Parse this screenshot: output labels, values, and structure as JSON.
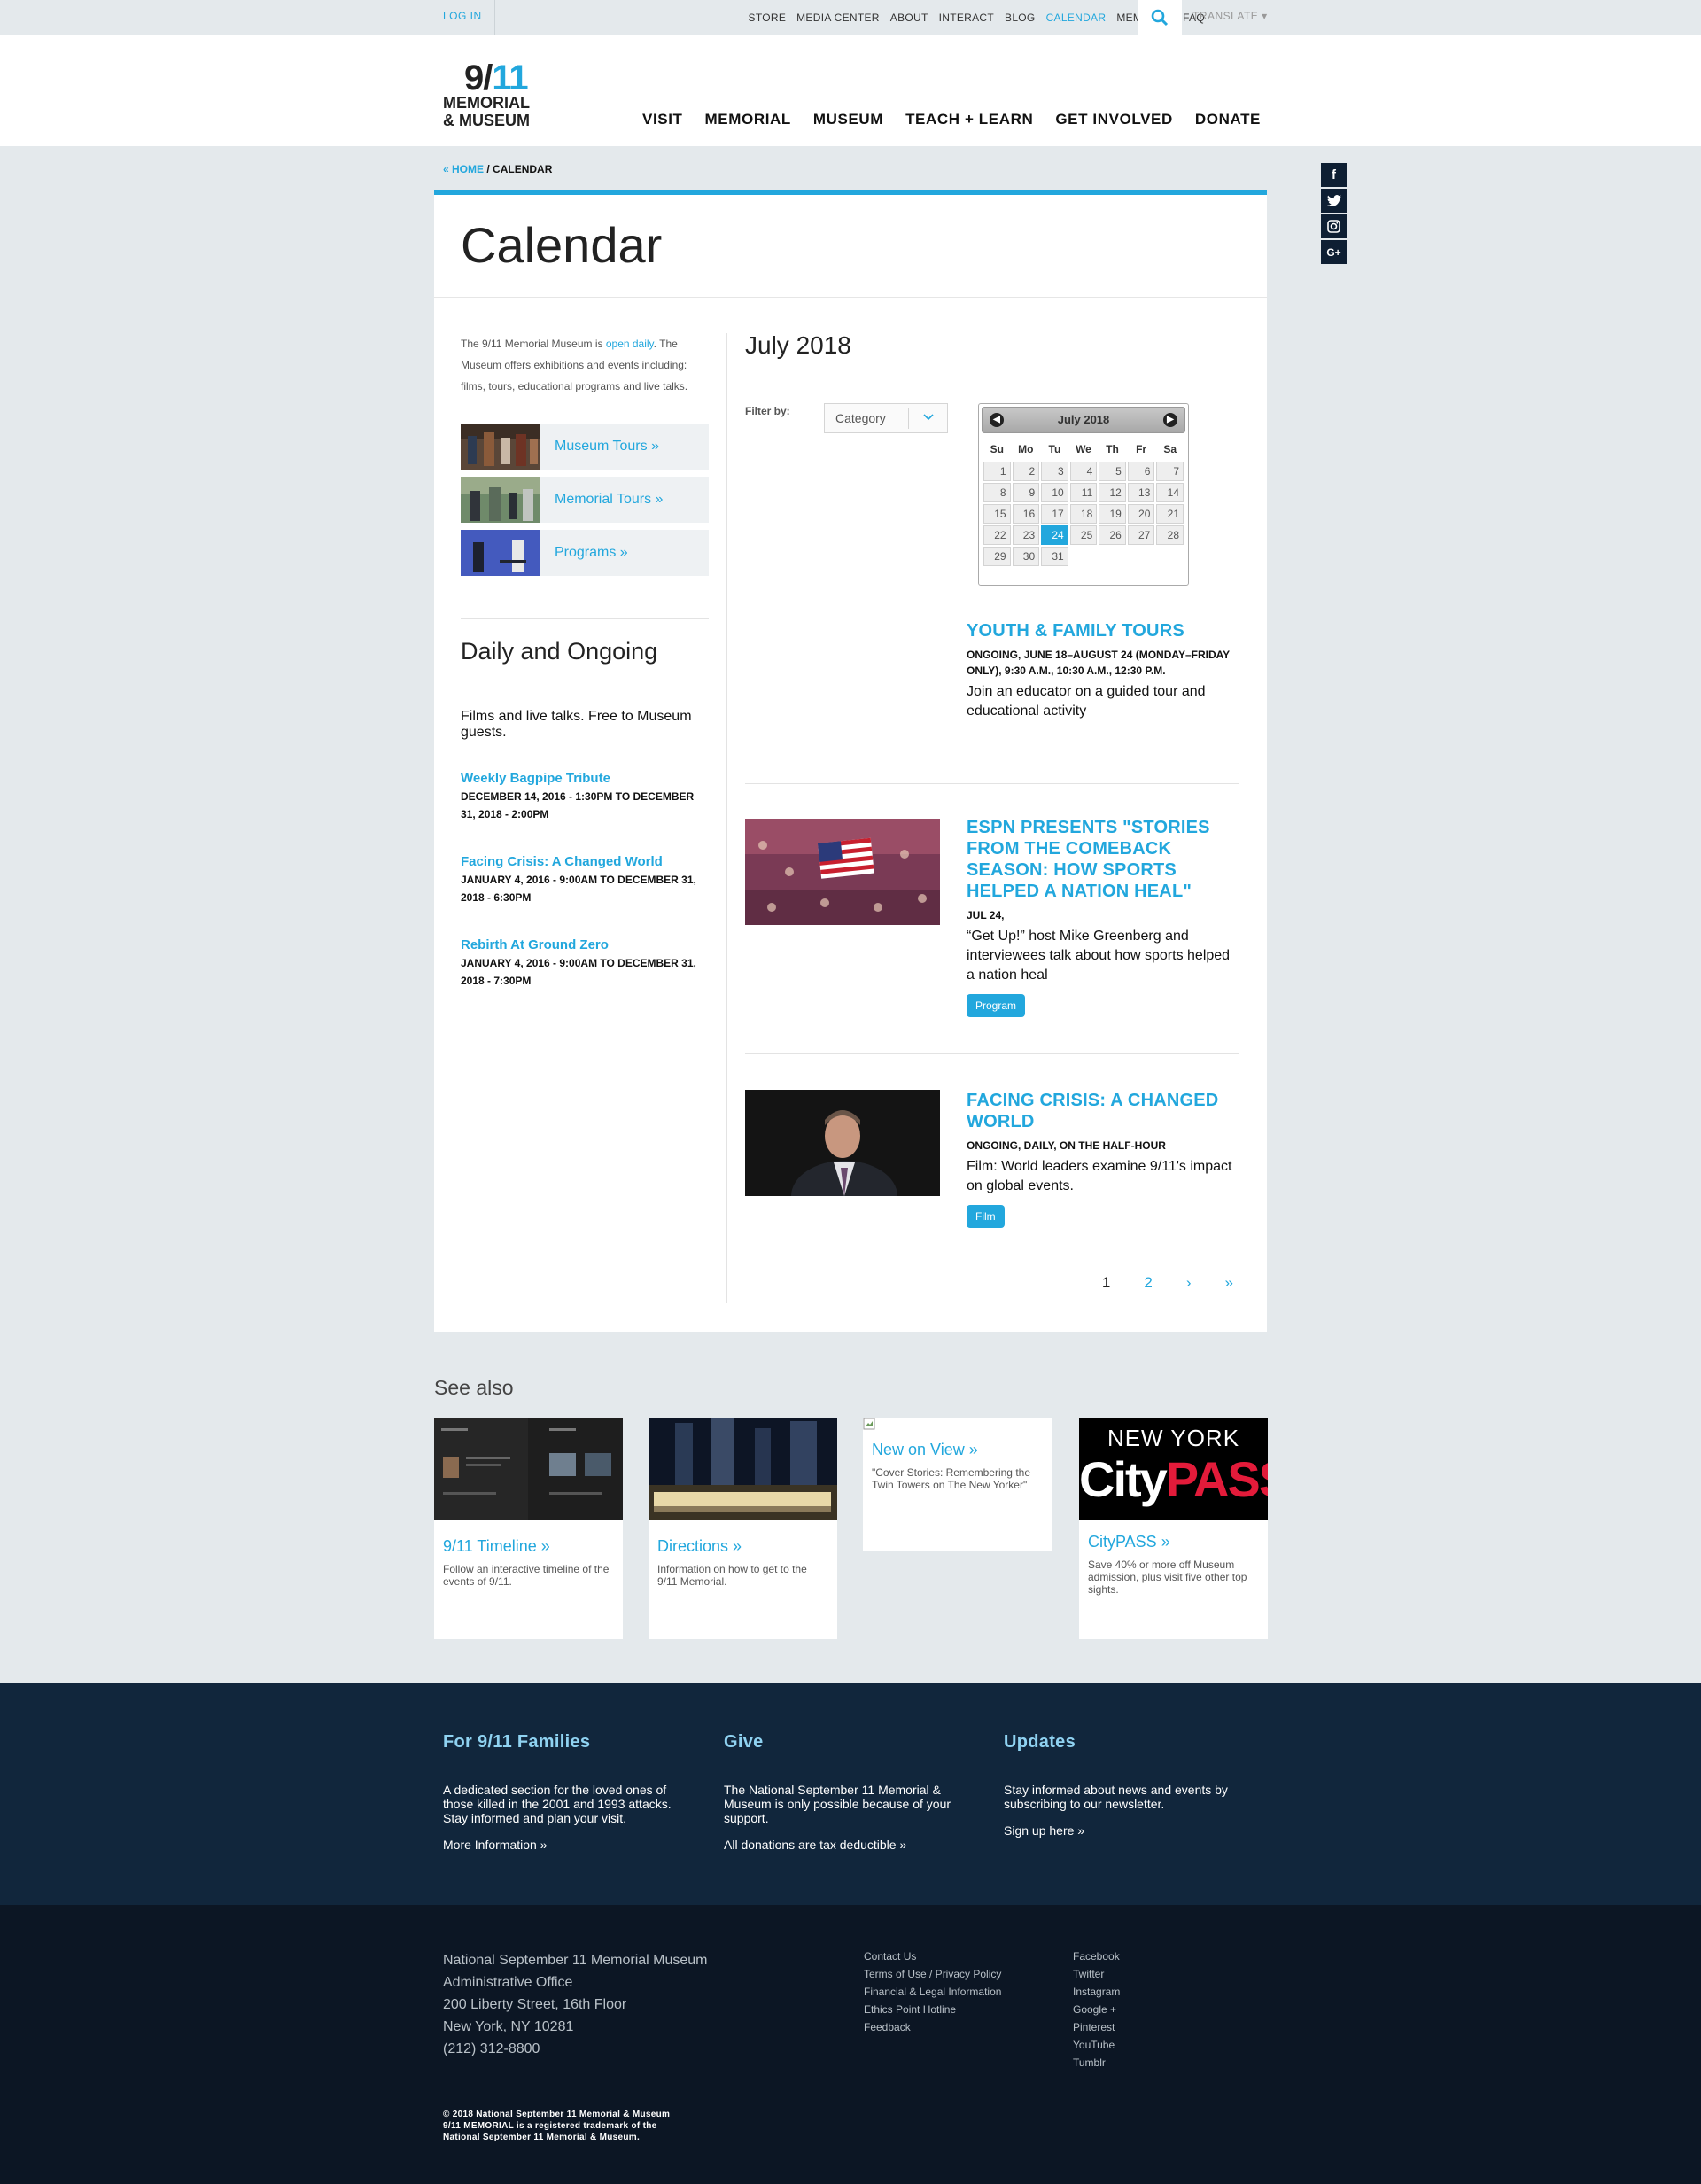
{
  "topbar": {
    "login": "LOG IN",
    "nav": [
      "STORE",
      "MEDIA CENTER",
      "ABOUT",
      "INTERACT",
      "BLOG",
      "CALENDAR",
      "MEMBERS",
      "FAQ"
    ],
    "active": "CALENDAR",
    "translate": "TRANSLATE ▾"
  },
  "logo": {
    "line1a": "9/",
    "line1b": "11",
    "line2": "MEMORIAL",
    "line3": "& MUSEUM"
  },
  "mainnav": [
    "VISIT",
    "MEMORIAL",
    "MUSEUM",
    "TEACH + LEARN",
    "GET INVOLVED",
    "DONATE"
  ],
  "breadcrumb": {
    "home": "« HOME",
    "sep": " / ",
    "current": "CALENDAR"
  },
  "social": [
    "f",
    "t",
    "ig",
    "G+"
  ],
  "page": {
    "title": "Calendar",
    "intro_pre": "The 9/11 Memorial Museum is ",
    "intro_link": "open daily",
    "intro_post": ". The Museum offers exhibitions and events including: films, tours, educational programs and live talks.",
    "side_buttons": [
      "Museum Tours »",
      "Memorial Tours »",
      "Programs »"
    ],
    "daily_title": "Daily and Ongoing",
    "daily_desc": "Films and live talks. Free to Museum guests.",
    "side_events": [
      {
        "title": "Weekly Bagpipe Tribute",
        "date": "December 14, 2016 - 1:30pm to December 31, 2018 - 2:00pm"
      },
      {
        "title": "Facing Crisis: A Changed World",
        "date": "January 4, 2016 - 9:00am to December 31, 2018 - 6:30pm"
      },
      {
        "title": "Rebirth At Ground Zero",
        "date": "January 4, 2016 - 9:00am to December 31, 2018 - 7:30pm"
      }
    ]
  },
  "calendar": {
    "month_title": "July 2018",
    "filter_label": "Filter by:",
    "category": "Category",
    "datepicker": {
      "title": "July 2018",
      "days": [
        "Su",
        "Mo",
        "Tu",
        "We",
        "Th",
        "Fr",
        "Sa"
      ],
      "selected": "24",
      "weeks": [
        [
          "1",
          "2",
          "3",
          "4",
          "5",
          "6",
          "7"
        ],
        [
          "8",
          "9",
          "10",
          "11",
          "12",
          "13",
          "14"
        ],
        [
          "15",
          "16",
          "17",
          "18",
          "19",
          "20",
          "21"
        ],
        [
          "22",
          "23",
          "24",
          "25",
          "26",
          "27",
          "28"
        ],
        [
          "29",
          "30",
          "31",
          "",
          "",
          "",
          ""
        ]
      ]
    }
  },
  "events": [
    {
      "title": "Youth & Family Tours",
      "date": "Ongoing, June 18–August 24 (Monday–Friday only), 9:30 a.m., 10:30 a.m., 12:30 p.m.",
      "excerpt": "Join an educator on a guided tour and educational activity",
      "tag": ""
    },
    {
      "title": "ESPN Presents \"Stories From The Comeback Season: How Sports Helped A Nation Heal\"",
      "date": "Jul 24,",
      "excerpt": "“Get Up!” host Mike Greenberg and interviewees talk about how sports helped a nation heal",
      "tag": "Program"
    },
    {
      "title": "Facing Crisis: A Changed World",
      "date": "Ongoing, Daily, on the half-hour",
      "excerpt": "Film: World leaders examine 9/11's impact on global events.",
      "tag": "Film"
    }
  ],
  "pager": [
    "1",
    "2",
    "›",
    "»"
  ],
  "seealso": {
    "title": "See also",
    "items": [
      {
        "title": "9/11 Timeline »",
        "desc": "Follow an interactive timeline of the events of 9/11."
      },
      {
        "title": "Directions »",
        "desc": "Information on how to get to the 9/11 Memorial."
      },
      {
        "title": "New on View »",
        "desc": "\"Cover Stories: Remembering the Twin Towers on The New Yorker\""
      },
      {
        "title": "CityPASS »",
        "desc": "Save 40% or more off Museum admission, plus visit five other top sights."
      }
    ],
    "citypass_line1": "NEW YORK",
    "citypass_city": "City",
    "citypass_pass": "PASS"
  },
  "footer": {
    "cols": [
      {
        "title": "For 9/11 Families",
        "desc": "A dedicated section for the loved ones of those killed in the 2001 and 1993 attacks. Stay informed and plan your visit.",
        "link": "More Information »"
      },
      {
        "title": "Give",
        "desc": "The National September 11 Memorial & Museum is only possible because of your support.",
        "link": "All donations are tax deductible »"
      },
      {
        "title": "Updates",
        "desc": "Stay informed about news and events by subscribing to our newsletter.",
        "link": "Sign up here »"
      }
    ],
    "address": [
      "National September 11 Memorial Museum",
      "Administrative Office",
      "200 Liberty Street, 16th Floor",
      "New York, NY 10281",
      "(212) 312-8800"
    ],
    "links": [
      "Contact Us",
      "Terms of Use / Privacy Policy",
      "Financial & Legal Information",
      "Ethics Point Hotline",
      "Feedback"
    ],
    "social_links": [
      "Facebook",
      "Twitter",
      "Instagram",
      "Google +",
      "Pinterest",
      "YouTube",
      "Tumblr"
    ],
    "copyright": [
      "© 2018 National September 11 Memorial & Museum",
      "9/11 MEMORIAL is a registered trademark of the",
      "National September 11 Memorial & Museum."
    ]
  },
  "colors": {
    "accent": "#22a7dd",
    "navy": "#11263c",
    "footer_dark": "#0c1624"
  }
}
